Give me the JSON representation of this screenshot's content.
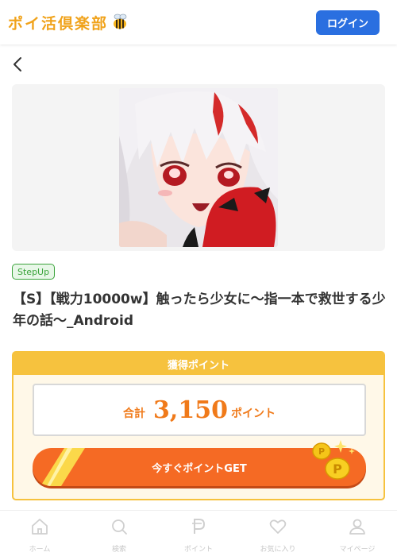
{
  "header": {
    "logo_text": "ポイ活倶楽部",
    "login_label": "ログイン"
  },
  "campaign": {
    "tag": "StepUp",
    "title": "【S】【戦力10000w】触ったら少女に〜指一本で救世する少年の話～_Android"
  },
  "points": {
    "header": "獲得ポイント",
    "total_label": "合計",
    "total_value": "3,150",
    "unit": "ポイント",
    "cta_label": "今すぐポイントGET"
  },
  "bottom_nav": {
    "items": [
      {
        "label": "ホーム",
        "icon": "home-icon"
      },
      {
        "label": "検索",
        "icon": "search-icon"
      },
      {
        "label": "ポイント",
        "icon": "point-icon"
      },
      {
        "label": "お気に入り",
        "icon": "heart-icon"
      },
      {
        "label": "マイページ",
        "icon": "user-icon"
      }
    ]
  },
  "colors": {
    "accent_blue": "#2a6fe0",
    "points_yellow": "#f6c23e",
    "cta_orange": "#f56a24",
    "tag_green": "#3aa33a"
  }
}
